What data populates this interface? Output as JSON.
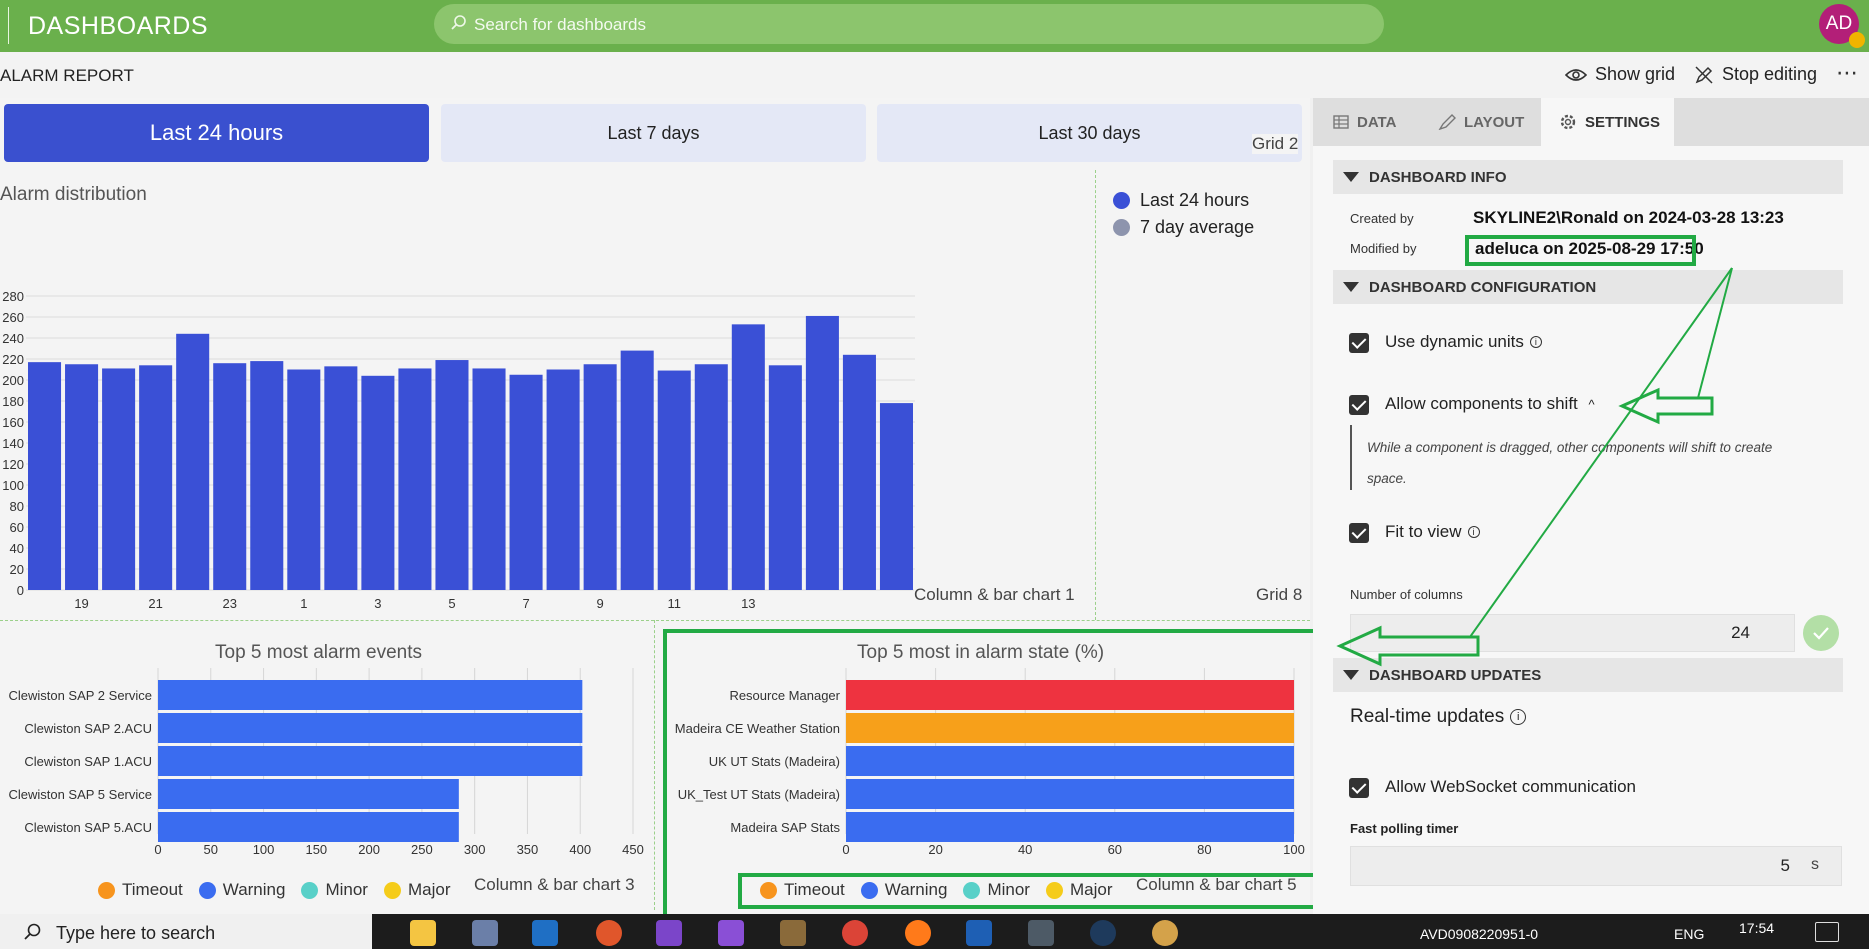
{
  "header": {
    "app_title": "DASHBOARDS",
    "search_placeholder": "Search for dashboards",
    "avatar_initials": "AD"
  },
  "report_bar": {
    "title": "ALARM REPORT",
    "show_grid_label": "Show grid",
    "stop_editing_label": "Stop editing",
    "more_label": "⋯"
  },
  "time_tabs": [
    {
      "label": "Last 24 hours",
      "active": true
    },
    {
      "label": "Last 7 days",
      "active": false
    },
    {
      "label": "Last 30 days",
      "active": false
    }
  ],
  "grid_labels": {
    "grid2": "Grid 2",
    "grid8": "Grid 8"
  },
  "component_labels": {
    "chart1": "Column & bar chart 1",
    "chart3": "Column & bar chart 3",
    "chart5": "Column & bar chart 5"
  },
  "legend_main": [
    {
      "label": "Last 24 hours",
      "color": "#3a50d6"
    },
    {
      "label": "7 day average",
      "color": "#8d94ad"
    }
  ],
  "severity_legend": [
    {
      "label": "Timeout",
      "color": "#f7941d"
    },
    {
      "label": "Warning",
      "color": "#3a6cf0"
    },
    {
      "label": "Minor",
      "color": "#58d0c8"
    },
    {
      "label": "Major",
      "color": "#f5cc1a"
    }
  ],
  "chart_data": [
    {
      "type": "bar",
      "title": "Alarm distribution",
      "x": [
        19,
        20,
        21,
        22,
        23,
        0,
        1,
        2,
        3,
        4,
        5,
        6,
        7,
        8,
        9,
        10,
        11,
        12,
        13,
        14,
        15,
        16,
        17
      ],
      "xticks": [
        "19",
        "21",
        "23",
        "1",
        "3",
        "5",
        "7",
        "9",
        "11",
        "13"
      ],
      "series": [
        {
          "name": "Last 24 hours",
          "values": [
            217,
            215,
            211,
            214,
            244,
            216,
            218,
            210,
            213,
            204,
            211,
            219,
            211,
            205,
            210,
            215,
            228,
            209,
            215,
            253,
            214,
            261,
            224,
            178
          ]
        }
      ],
      "ylim": [
        0,
        280
      ],
      "yticks": [
        0,
        20,
        40,
        60,
        80,
        100,
        120,
        140,
        160,
        180,
        200,
        220,
        240,
        260,
        280
      ],
      "grid": true,
      "legend": "top-right",
      "color": "#3a50d6"
    },
    {
      "type": "bar",
      "orientation": "horizontal",
      "title": "Top 5 most alarm events",
      "categories": [
        "Clewiston SAP 2 Service",
        "Clewiston SAP 2.ACU",
        "Clewiston SAP 1.ACU",
        "Clewiston SAP 5 Service",
        "Clewiston SAP 5.ACU"
      ],
      "values": [
        402,
        402,
        402,
        285,
        285
      ],
      "colors": [
        "#3a6cf0",
        "#3a6cf0",
        "#3a6cf0",
        "#3a6cf0",
        "#3a6cf0"
      ],
      "xlim": [
        0,
        450
      ],
      "xticks": [
        0,
        50,
        100,
        150,
        200,
        250,
        300,
        350,
        400,
        450
      ],
      "grid": true,
      "legend": "bottom"
    },
    {
      "type": "bar",
      "orientation": "horizontal",
      "title": "Top 5 most in alarm state (%)",
      "categories": [
        "Resource Manager",
        "Madeira CE Weather Station",
        "UK UT Stats (Madeira)",
        "UK_Test UT Stats (Madeira)",
        "Madeira SAP Stats"
      ],
      "values": [
        100,
        100,
        100,
        100,
        100
      ],
      "colors": [
        "#ee3340",
        "#f7a01a",
        "#3a6cf0",
        "#3a6cf0",
        "#3a6cf0"
      ],
      "xlim": [
        0,
        100
      ],
      "xticks": [
        0,
        20,
        40,
        60,
        80,
        100
      ],
      "grid": true,
      "legend": "bottom"
    }
  ],
  "panel": {
    "tabs": [
      {
        "label": "DATA",
        "icon": "table-icon",
        "active": false
      },
      {
        "label": "LAYOUT",
        "icon": "brush-icon",
        "active": false
      },
      {
        "label": "SETTINGS",
        "icon": "gear-icon",
        "active": true
      }
    ],
    "dashboard_info": {
      "heading": "DASHBOARD INFO",
      "created_by_label": "Created by",
      "created_by_value": "SKYLINE2\\Ronald on 2024-03-28 13:23",
      "modified_by_label": "Modified by",
      "modified_by_value": "adeluca on 2025-08-29 17:50"
    },
    "dashboard_configuration": {
      "heading": "DASHBOARD CONFIGURATION",
      "use_dynamic_units": "Use dynamic units",
      "allow_shift": "Allow components to shift",
      "allow_shift_desc": "While a component is dragged, other components will shift to create space.",
      "fit_to_view": "Fit to view",
      "columns_label": "Number of columns",
      "columns_value": "24"
    },
    "dashboard_updates": {
      "heading": "DASHBOARD UPDATES",
      "realtime_title": "Real-time updates",
      "allow_websocket": "Allow WebSocket communication",
      "fast_polling_label": "Fast polling timer",
      "fast_polling_value": "5",
      "fast_polling_unit": "s"
    }
  },
  "taskbar": {
    "search_placeholder": "Type here to search",
    "host": "AVD0908220951-0",
    "language": "ENG",
    "time": "17:54"
  }
}
